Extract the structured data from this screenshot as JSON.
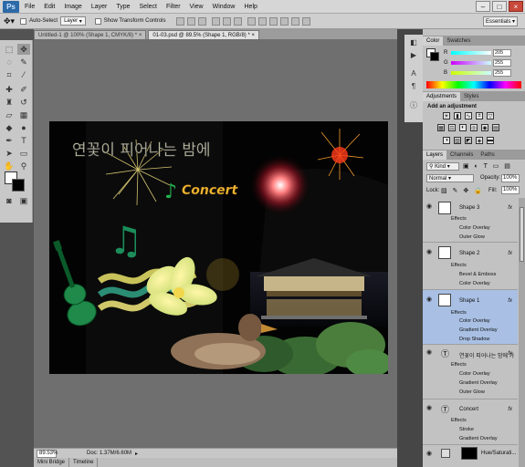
{
  "app": {
    "logo": "Ps"
  },
  "menu": [
    "File",
    "Edit",
    "Image",
    "Layer",
    "Type",
    "Select",
    "Filter",
    "View",
    "Window",
    "Help"
  ],
  "options": {
    "auto_select": "Auto-Select",
    "target": "Layer",
    "transform": "Show Transform Controls",
    "workspace": "Essentials"
  },
  "tabs": [
    {
      "label": "Untitled-1 @ 100% (Shape 1, CMYK/8) *",
      "close": "×"
    },
    {
      "label": "01-03.psd @ 89.5% (Shape 1, RGB/8) *",
      "close": "×"
    }
  ],
  "artwork": {
    "title_text": "연꽃이 피어나는 밤에",
    "concert": "Concert"
  },
  "status": {
    "zoom": "89.53%",
    "doc": "Doc: 1.37M/6.60M"
  },
  "bottom_tabs": [
    "Mini Bridge",
    "Timeline"
  ],
  "color_panel": {
    "tabs": [
      "Color",
      "Swatches"
    ],
    "channels": [
      {
        "label": "R",
        "value": "205",
        "color": "#ff3a3a"
      },
      {
        "label": "G",
        "value": "255",
        "color": "#46f046"
      },
      {
        "label": "B",
        "value": "255",
        "color": "#5050ff"
      }
    ]
  },
  "adjust_panel": {
    "tabs": [
      "Adjustments",
      "Styles"
    ],
    "heading": "Add an adjustment"
  },
  "layers_panel": {
    "tabs": [
      "Layers",
      "Channels",
      "Paths"
    ],
    "filter": "Kind",
    "blend": "Normal",
    "opacity_label": "Opacity:",
    "opacity": "100%",
    "lock_label": "Lock:",
    "fill_label": "Fill:",
    "fill": "100%",
    "effects_label": "Effects",
    "fx": "fx",
    "layers": [
      {
        "name": "Shape 3",
        "effects": [
          "Color Overlay",
          "Outer Glow"
        ]
      },
      {
        "name": "Shape 2",
        "effects": [
          "Bevel & Emboss",
          "Color Overlay"
        ]
      },
      {
        "name": "Shape 1",
        "effects": [
          "Color Overlay",
          "Gradient Overlay",
          "Drop Shadow"
        ]
      },
      {
        "name": "연꽃이 피어나는 밤에 가",
        "effects": [
          "Color Overlay",
          "Gradient Overlay",
          "Outer Glow"
        ]
      },
      {
        "name": "Concert",
        "effects": [
          "Stroke",
          "Gradient Overlay"
        ]
      },
      {
        "name": "Hue/Saturati..."
      }
    ]
  }
}
